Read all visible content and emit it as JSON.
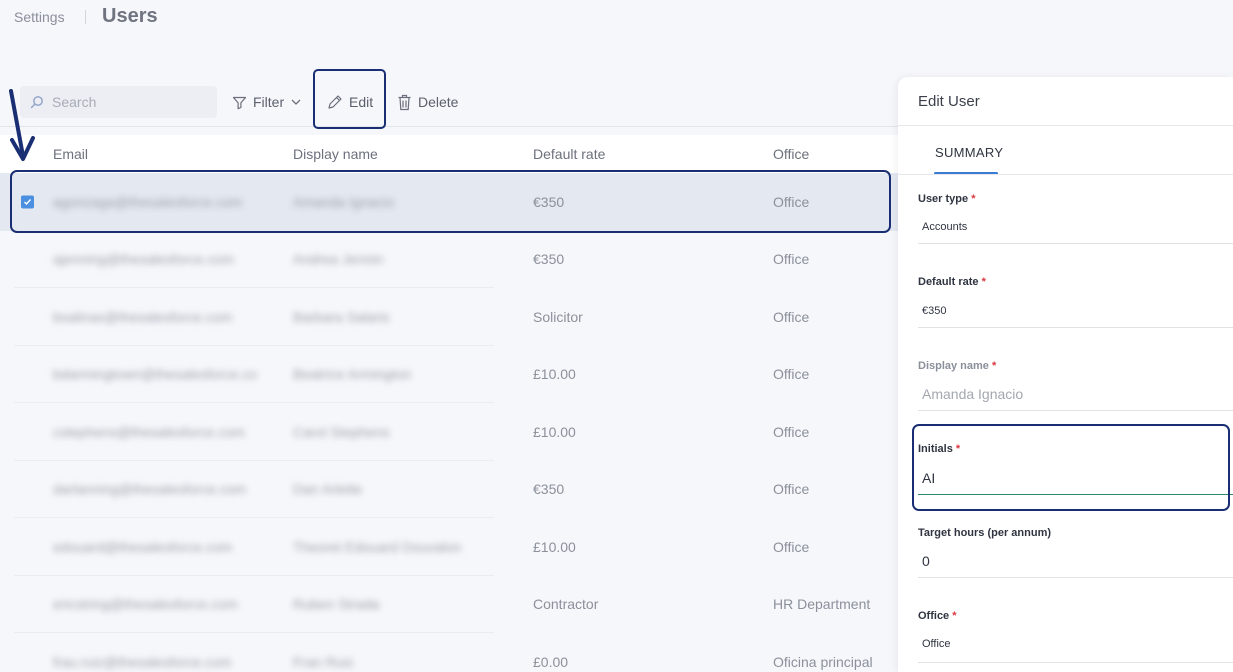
{
  "header": {
    "breadcrumb": "Settings",
    "title": "Users"
  },
  "toolbar": {
    "search_placeholder": "Search",
    "filter_label": "Filter",
    "edit_label": "Edit",
    "delete_label": "Delete"
  },
  "table": {
    "columns": [
      "Email",
      "Display name",
      "Default rate",
      "Office"
    ],
    "rows": [
      {
        "email": "agonzaga@thesalesforce.com",
        "display_name": "Amanda Ignacio",
        "rate": "€350",
        "office": "Office",
        "selected": true
      },
      {
        "email": "ajenning@thesalesforce.com",
        "display_name": "Andrea Jennin",
        "rate": "€350",
        "office": "Office",
        "selected": false
      },
      {
        "email": "bsalinas@thesalesforce.com",
        "display_name": "Barbara Salaris",
        "rate": "Solicitor",
        "office": "Office",
        "selected": false
      },
      {
        "email": "bdarmingtown@thesalesforce.co",
        "display_name": "Beatrice Armington",
        "rate": "£10.00",
        "office": "Office",
        "selected": false
      },
      {
        "email": "cstephens@thesalesforce.com",
        "display_name": "Carol Stephens",
        "rate": "£10.00",
        "office": "Office",
        "selected": false
      },
      {
        "email": "darlanning@thesalesforce.com",
        "display_name": "Dan Arlette",
        "rate": "€350",
        "office": "Office",
        "selected": false
      },
      {
        "email": "edouard@thesalesforce.com",
        "display_name": "Theoret Edouard Douvalon",
        "rate": "£10.00",
        "office": "Office",
        "selected": false
      },
      {
        "email": "ericstring@thesalesforce.com",
        "display_name": "Ruben Strada",
        "rate": "Contractor",
        "office": "HR Department",
        "selected": false
      },
      {
        "email": "frau.ruiz@thesalesforce.com",
        "display_name": "Fran Ruiz",
        "rate": "£0.00",
        "office": "Oficina principal",
        "selected": false
      }
    ]
  },
  "panel": {
    "title": "Edit User",
    "tab": "SUMMARY",
    "fields": {
      "user_type": {
        "label": "User type",
        "value": "Accounts"
      },
      "default_rate": {
        "label": "Default rate",
        "value": "€350"
      },
      "display_name": {
        "label": "Display name",
        "value": "Amanda  Ignacio"
      },
      "initials": {
        "label": "Initials",
        "value": "AI"
      },
      "target_hours": {
        "label": "Target hours (per annum)",
        "value": "0"
      },
      "office": {
        "label": "Office",
        "value": "Office"
      }
    },
    "required_mark": "*"
  },
  "colors": {
    "highlight": "#1a2f73",
    "accent": "#3a7bd5",
    "checkbox": "#4a8fe0",
    "required": "#d9363e"
  }
}
